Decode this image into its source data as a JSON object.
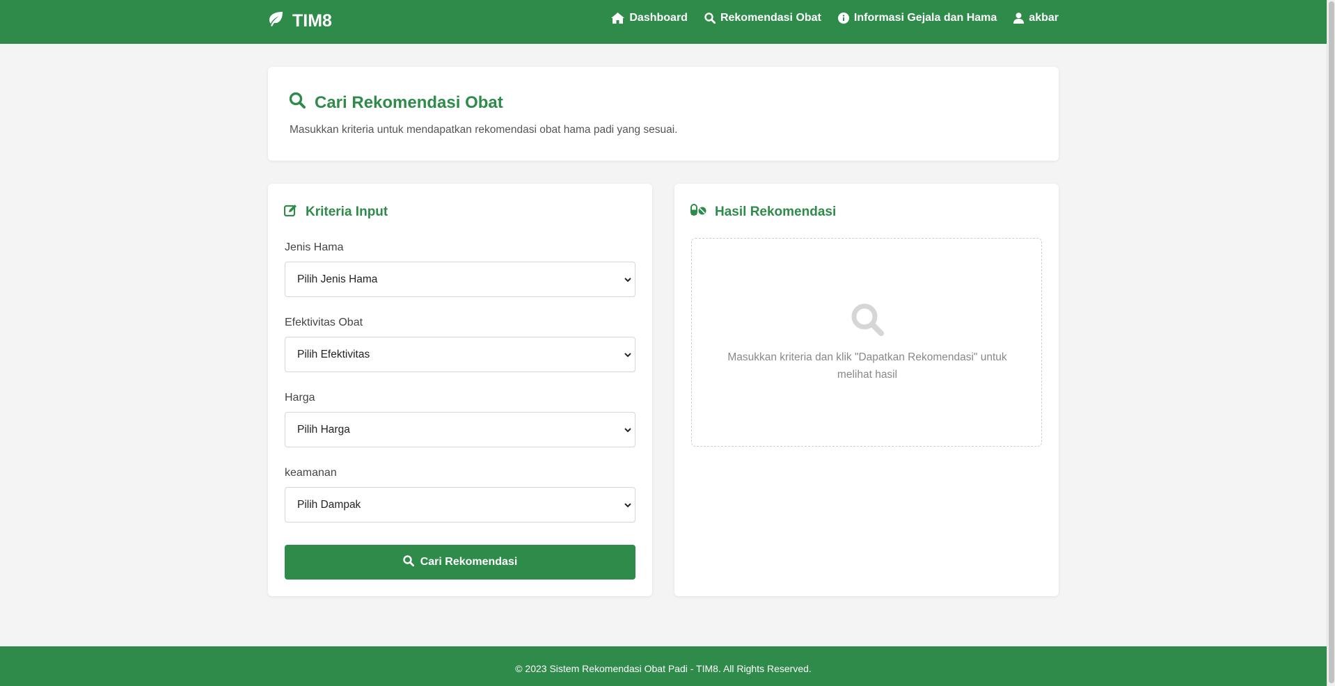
{
  "navbar": {
    "brand": "TIM8",
    "links": [
      {
        "label": "Dashboard",
        "icon": "home-icon"
      },
      {
        "label": "Rekomendasi Obat",
        "icon": "search-icon"
      },
      {
        "label": "Informasi Gejala dan Hama",
        "icon": "info-icon"
      },
      {
        "label": "akbar",
        "icon": "user-icon"
      }
    ]
  },
  "header": {
    "title": "Cari Rekomendasi Obat",
    "subtitle": "Masukkan kriteria untuk mendapatkan rekomendasi obat hama padi yang sesuai."
  },
  "form": {
    "title": "Kriteria Input",
    "fields": [
      {
        "label": "Jenis Hama",
        "selected": "Pilih Jenis Hama"
      },
      {
        "label": "Efektivitas Obat",
        "selected": "Pilih Efektivitas"
      },
      {
        "label": "Harga",
        "selected": "Pilih Harga"
      },
      {
        "label": "keamanan",
        "selected": "Pilih Dampak"
      }
    ],
    "submit_label": "Cari Rekomendasi"
  },
  "result": {
    "title": "Hasil Rekomendasi",
    "empty_message": "Masukkan kriteria dan klik \"Dapatkan Rekomendasi\" untuk melihat hasil"
  },
  "footer": {
    "text": "© 2023 Sistem Rekomendasi Obat Padi - TIM8. All Rights Reserved."
  },
  "colors": {
    "primary": "#2e8b4a",
    "background": "#f4f4f4"
  }
}
